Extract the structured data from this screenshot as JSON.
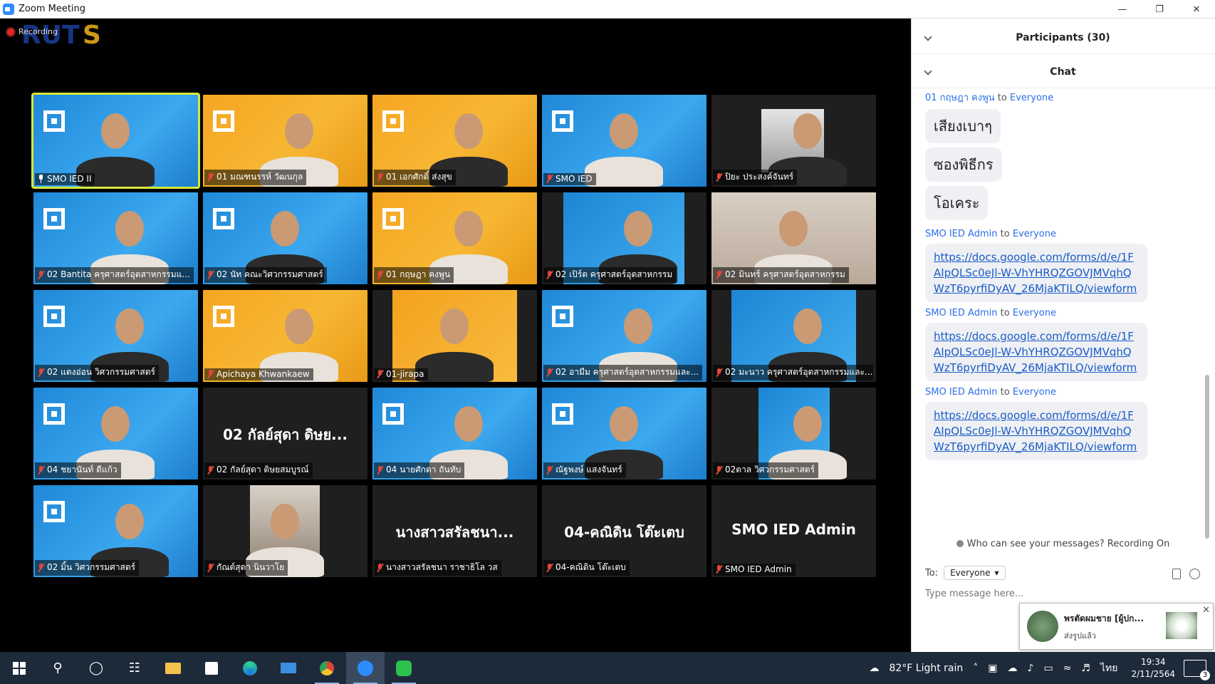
{
  "window": {
    "title": "Zoom Meeting",
    "controls": [
      "—",
      "❐",
      "✕"
    ]
  },
  "recording": {
    "label": "Recording"
  },
  "tiles": [
    {
      "name": "SMO IED II",
      "bg": "blue",
      "kind": "video",
      "active": true,
      "pinned": true
    },
    {
      "name": "01 มณฑนรรห์ วัฒนกุล",
      "bg": "orange",
      "kind": "video"
    },
    {
      "name": "01 เอกศักดิ์ ส่งสุข",
      "bg": "orange",
      "kind": "video"
    },
    {
      "name": "SMO IED",
      "bg": "blue",
      "kind": "video"
    },
    {
      "name": "ปิยะ ประสงค์จันทร์",
      "bg": "dark",
      "kind": "inset",
      "inset": "gray"
    },
    {
      "name": "02 Bantita ครุศาสตร์อุตสาหกรรมแ...",
      "bg": "blue",
      "kind": "video"
    },
    {
      "name": "02 นัท คณะวิศวกรรมศาสตร์",
      "bg": "blue",
      "kind": "video"
    },
    {
      "name": "01 กฤษฎา คงพูน",
      "bg": "orange",
      "kind": "video"
    },
    {
      "name": "02 เปิร์ต ครุศาสตร์อุตสาหกรรม",
      "bg": "dark",
      "kind": "inset",
      "inset": "blue"
    },
    {
      "name": "02 มินทร์ ครุศาสตร์อุตสาหกรรม",
      "bg": "room",
      "kind": "video"
    },
    {
      "name": "02 แตงอ่อน วิศวกรรมศาสตร์",
      "bg": "blue",
      "kind": "video"
    },
    {
      "name": "Apichaya Khwankaew",
      "bg": "orange",
      "kind": "video"
    },
    {
      "name": "01-jirapa",
      "bg": "dark",
      "kind": "inset",
      "inset": "orange"
    },
    {
      "name": "02 อามีม ครุศาสตร์อุตสาหกรรมและ...",
      "bg": "blue",
      "kind": "video"
    },
    {
      "name": "02 มะนาว ครุศาสตร์อุตสาหกรรมและ...",
      "bg": "dark",
      "kind": "inset",
      "inset": "blue"
    },
    {
      "name": "04 ชยานันท์ ดีแก้ว",
      "bg": "blue",
      "kind": "video"
    },
    {
      "name": "02 กัลย์สุดา ดิษยสมบูรณ์",
      "bg": "dark",
      "kind": "text",
      "big": "02 กัลย์สุดา ดิษย..."
    },
    {
      "name": "04 นายศักดา ถันทับ",
      "bg": "blue",
      "kind": "video"
    },
    {
      "name": "ณัฐพงษ์ แสงจันทร์",
      "bg": "blue",
      "kind": "video"
    },
    {
      "name": "02ตาล วิศวกรรมศาสตร์",
      "bg": "dark",
      "kind": "inset",
      "inset": "blue"
    },
    {
      "name": "02 มิ้น วิศวกรรมศาสตร์",
      "bg": "blue",
      "kind": "video"
    },
    {
      "name": "กัณต์สุดา นินวาโย",
      "bg": "dark",
      "kind": "inset",
      "inset": "room"
    },
    {
      "name": "นางสาวสรัลชนา ราชาธิโล วส",
      "bg": "dark",
      "kind": "text",
      "big": "นางสาวสรัลชนา..."
    },
    {
      "name": "04-คณิดิน โต๊ะเตบ",
      "bg": "dark",
      "kind": "text",
      "big": "04-คณิดิน โต๊ะเตบ"
    },
    {
      "name": "SMO IED Admin",
      "bg": "dark",
      "kind": "text",
      "big": "SMO IED Admin"
    }
  ],
  "panel": {
    "participants_title": "Participants (30)",
    "chat_title": "Chat",
    "messages": [
      {
        "sender": "01 กฤษฎา คงพูน",
        "to_word": "to",
        "target": "Everyone",
        "bubbles": [
          "เสียงเบาๆ",
          "ซองพิธีกร",
          "โอเคระ"
        ]
      },
      {
        "sender": "SMO IED Admin",
        "to_word": "to",
        "target": "Everyone",
        "link": "https://docs.google.com/forms/d/e/1FAIpQLSc0eJl-W-VhYHRQZGOVJMVqhQWzT6pyrfiDyAV_26MjaKTILQ/viewform"
      },
      {
        "sender": "SMO IED Admin",
        "to_word": "to",
        "target": "Everyone",
        "link": "https://docs.google.com/forms/d/e/1FAIpQLSc0eJl-W-VhYHRQZGOVJMVqhQWzT6pyrfiDyAV_26MjaKTILQ/viewform"
      },
      {
        "sender": "SMO IED Admin",
        "to_word": "to",
        "target": "Everyone",
        "link": "https://docs.google.com/forms/d/e/1FAIpQLSc0eJl-W-VhYHRQZGOVJMVqhQWzT6pyrfiDyAV_26MjaKTILQ/viewform"
      }
    ],
    "who_can_see": "Who can see your messages? Recording On",
    "to_label": "To:",
    "to_value": "Everyone",
    "input_placeholder": "Type message here..."
  },
  "toast": {
    "name": "พรตัดผมชาย [ผู้ปก...",
    "sub": "ส่งรูปแล้ว",
    "close": "✕"
  },
  "taskbar": {
    "weather": "82°F  Light rain",
    "language": "ไทย",
    "time": "19:34",
    "date": "2/11/2564",
    "notifications": "3"
  }
}
